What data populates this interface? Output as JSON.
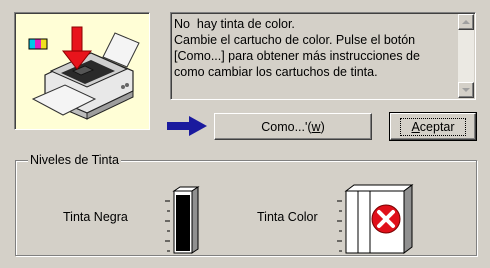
{
  "message": {
    "text": "No  hay tinta de color.\nCambie el cartucho de color. Pulse el botón\n[Como...] para obtener más instrucciones de\ncomo cambiar los cartuchos de tinta."
  },
  "buttons": {
    "como_label": "Como...'(",
    "como_hotkey": "w",
    "como_suffix": ")",
    "aceptar_hotkey": "A",
    "aceptar_rest": "ceptar"
  },
  "ink_levels": {
    "group_title": "Niveles de Tinta",
    "black_label": "Tinta Negra",
    "color_label": "Tinta Color",
    "black_level": 1.0,
    "color_status": "empty"
  },
  "icons": {
    "printer": "printer-icon",
    "arrow": "blue-arrow-icon",
    "error": "error-x-icon"
  },
  "colors": {
    "window_bg": "#d4d0c8",
    "printer_bg": "#fffed6",
    "arrow_blue": "#1a1a9e",
    "error_red": "#e0101a"
  }
}
